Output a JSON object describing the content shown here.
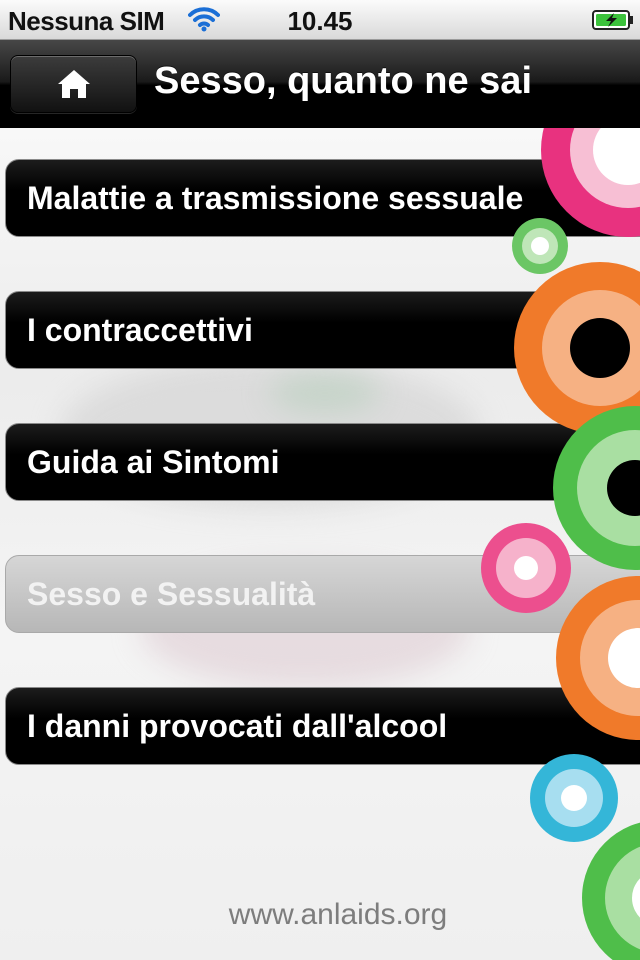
{
  "status_bar": {
    "carrier": "Nessuna SIM",
    "time": "10.45",
    "wifi_icon": "wifi-icon",
    "battery_icon": "battery-charging-icon"
  },
  "nav_bar": {
    "home_icon": "home-icon",
    "title": "Sesso, quanto ne sai"
  },
  "menu": {
    "items": [
      {
        "label": "Malattie a trasmissione sessuale",
        "selected": false
      },
      {
        "label": "I contraccettivi",
        "selected": false
      },
      {
        "label": "Guida ai Sintomi",
        "selected": false
      },
      {
        "label": "Sesso e Sessualità",
        "selected": true
      },
      {
        "label": "I danni provocati dall'alcool",
        "selected": false
      }
    ]
  },
  "footer": {
    "url": "www.anlaids.org"
  },
  "colors": {
    "ring_pink": "#e8327f",
    "ring_orange": "#f07a2a",
    "ring_green": "#4fbe4a",
    "ring_cyan": "#34b6d8",
    "ring_peach": "#f6b183"
  }
}
